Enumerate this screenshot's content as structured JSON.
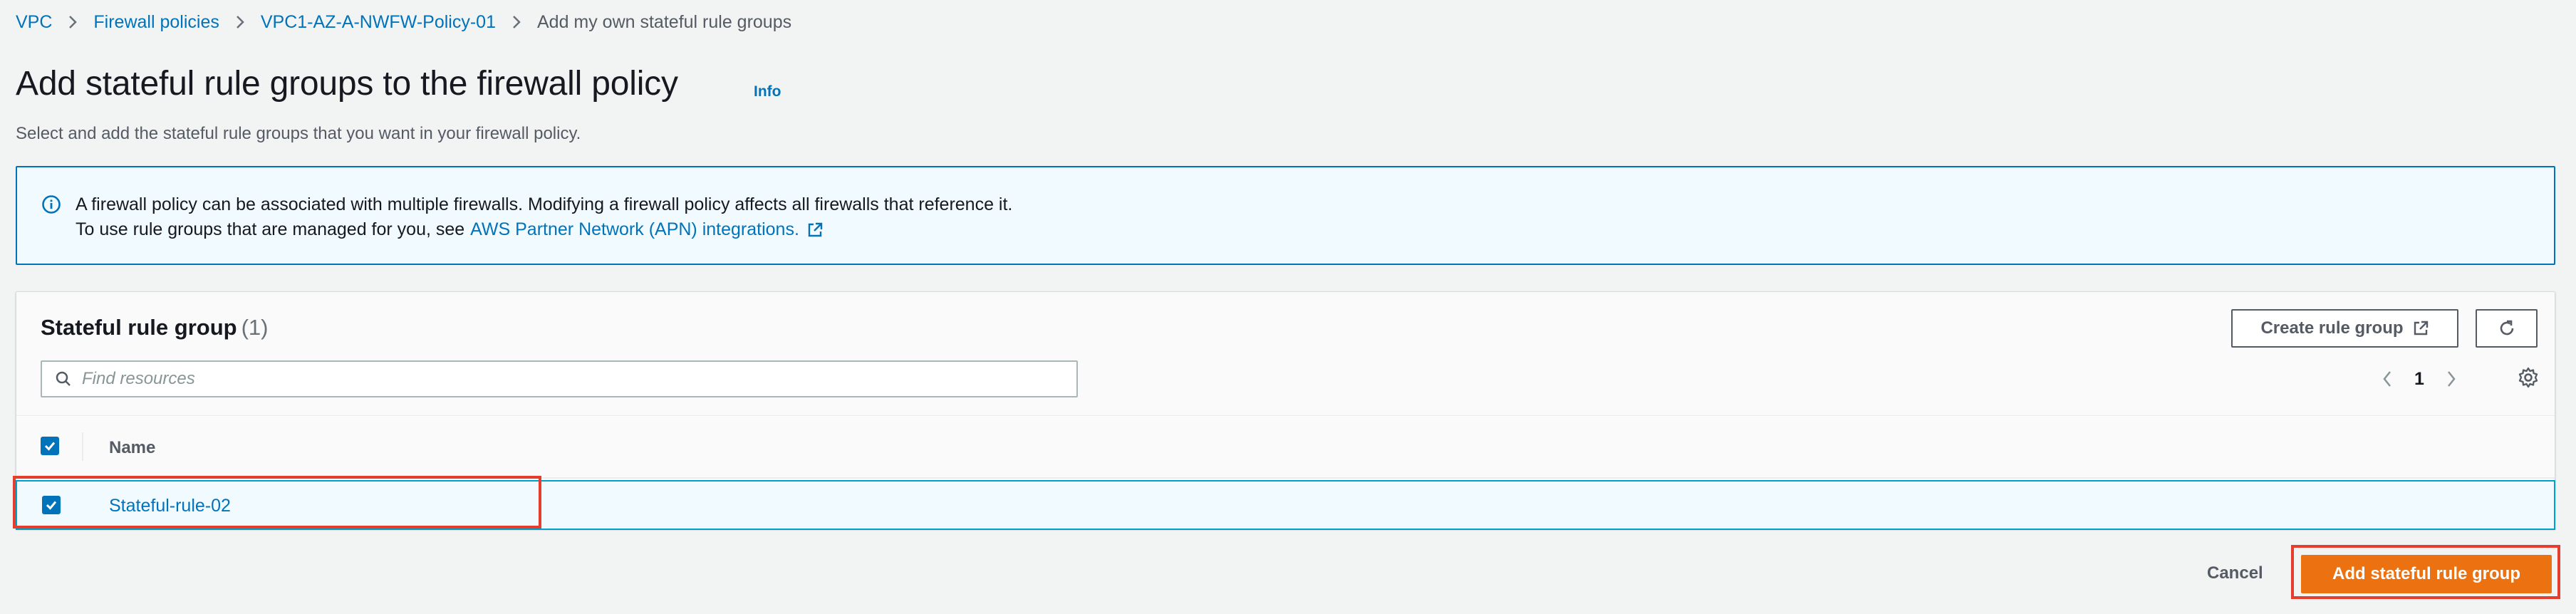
{
  "breadcrumb": {
    "items": [
      {
        "label": "VPC"
      },
      {
        "label": "Firewall policies"
      },
      {
        "label": "VPC1-AZ-A-NWFW-Policy-01"
      },
      {
        "label": "Add my own stateful rule groups"
      }
    ]
  },
  "header": {
    "title": "Add stateful rule groups to the firewall policy",
    "info_label": "Info",
    "description": "Select and add the stateful rule groups that you want in your firewall policy."
  },
  "alert": {
    "line1": "A firewall policy can be associated with multiple firewalls. Modifying a firewall policy affects all firewalls that reference it.",
    "line2_prefix": "To use rule groups that are managed for you, see",
    "line2_link": "AWS Partner Network (APN) integrations."
  },
  "table": {
    "title": "Stateful rule group",
    "count": "(1)",
    "create_button_label": "Create rule group",
    "search_placeholder": "Find resources",
    "current_page": "1",
    "columns": [
      "Name"
    ],
    "rows": [
      {
        "name": "Stateful-rule-02",
        "selected": true
      }
    ],
    "select_all_checked": true
  },
  "footer": {
    "cancel_label": "Cancel",
    "submit_label": "Add stateful rule group"
  },
  "colors": {
    "link": "#0073bb",
    "primary_button": "#ec7211",
    "annotation_highlight": "#e53e2f",
    "info_border": "#0073bb"
  },
  "icons": {
    "alert": "info-circle-icon",
    "external": "external-link-icon",
    "refresh": "refresh-icon",
    "search": "search-icon",
    "settings": "gear-icon"
  }
}
